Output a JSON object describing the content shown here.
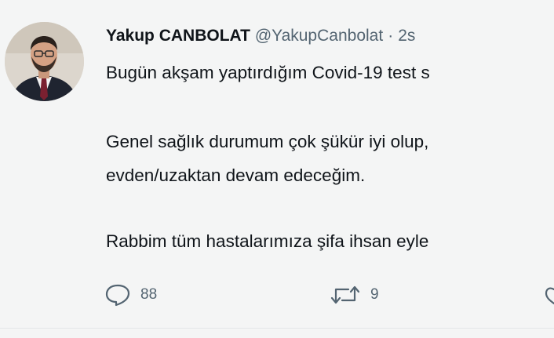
{
  "tweet": {
    "display_name": "Yakup CANBOLAT",
    "handle": "@YakupCanbolat",
    "separator": "·",
    "time": "2s",
    "lines": [
      "Bugün akşam yaptırdığım Covid-19 test s",
      "Genel sağlık durumum çok şükür iyi olup,",
      "evden/uzaktan devam edeceğim.",
      "Rabbim tüm hastalarımıza şifa ihsan eyle"
    ]
  },
  "actions": {
    "reply": {
      "icon": "reply-icon",
      "count": "88"
    },
    "retweet": {
      "icon": "retweet-icon",
      "count": "9"
    },
    "like": {
      "icon": "like-icon"
    }
  },
  "colors": {
    "background": "#f4f5f5",
    "text": "#0f1419",
    "secondary": "#536471"
  }
}
